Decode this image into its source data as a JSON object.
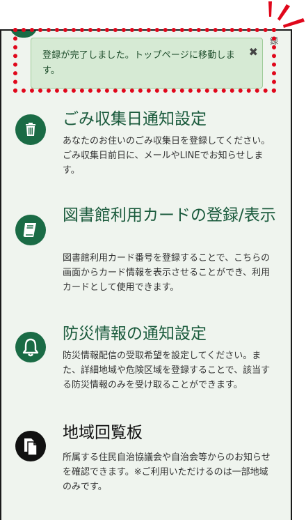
{
  "toast": {
    "message": "登録が完了しました。トップページに移動します。",
    "close_glyph": "✖"
  },
  "peek_text": "録",
  "items": [
    {
      "title": "ごみ収集日通知設定",
      "description": "あなたのお住いのごみ収集日を登録してください。ごみ収集日前日に、メールやLINEでお知らせします。",
      "icon": "trash-icon"
    },
    {
      "title": "図書館利用カードの登録/表示",
      "description": "図書館利用カード番号を登録することで、こちらの画面からカード情報を表示させることができ、利用カードとして使用できます。",
      "icon": "book-icon"
    },
    {
      "title": "防災情報の通知設定",
      "description": "防災情報配信の受取希望を設定してください。また、詳細地域や危険区域を登録することで、該当する防災情報のみを受け取ることができます。",
      "icon": "bell-icon"
    },
    {
      "title": "地域回覧板",
      "description": "所属する住民自治協議会や自治会等からのお知らせを確認できます。※ご利用いただけるのは一部地域のみです。",
      "icon": "documents-icon"
    }
  ],
  "colors": {
    "accent_green": "#1a6b45",
    "highlight_red": "#e0071b",
    "toast_bg": "#d6ead4",
    "page_bg": "#eff4ee"
  }
}
